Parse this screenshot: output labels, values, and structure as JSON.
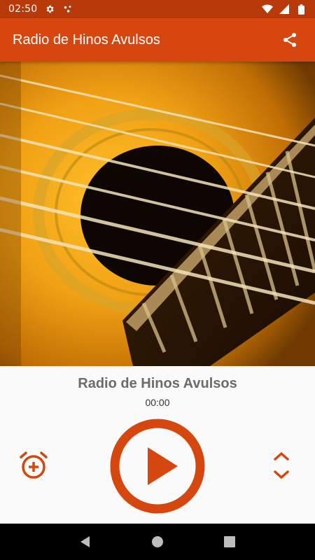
{
  "status_bar": {
    "time": "02:50",
    "icons": [
      "gear-icon",
      "dots-icon",
      "wifi-icon",
      "signal-icon",
      "battery-icon"
    ]
  },
  "app_bar": {
    "title": "Radio de Hinos Avulsos",
    "share_icon": "share-icon"
  },
  "colors": {
    "status_bar": "#b8390a",
    "app_bar": "#d5470f",
    "accent": "#d5470f",
    "player_bg": "#fafafa"
  },
  "player": {
    "title": "Radio de Hinos Avulsos",
    "time": "00:00",
    "alarm_icon": "alarm-add-icon",
    "play_icon": "play-icon",
    "expand_icon": "unfold-icon"
  },
  "nav": {
    "icons": [
      "back-icon",
      "home-icon",
      "recents-icon"
    ]
  }
}
